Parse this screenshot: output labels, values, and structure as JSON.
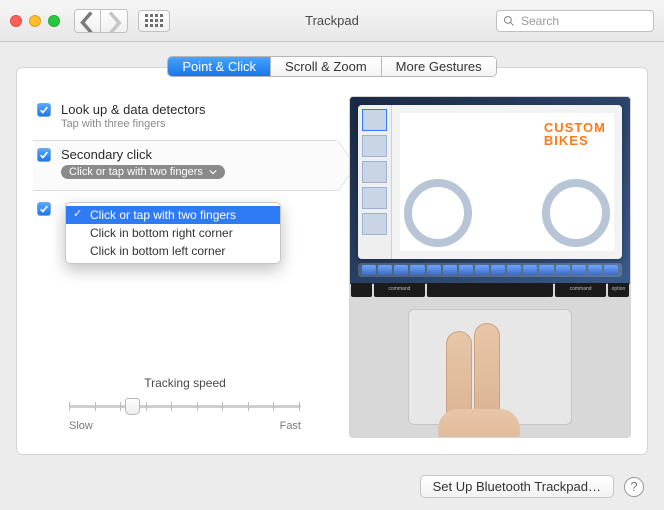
{
  "window": {
    "title": "Trackpad",
    "search_placeholder": "Search"
  },
  "tabs": [
    {
      "label": "Point & Click",
      "active": true
    },
    {
      "label": "Scroll & Zoom",
      "active": false
    },
    {
      "label": "More Gestures",
      "active": false
    }
  ],
  "options": {
    "lookup": {
      "title": "Look up & data detectors",
      "sub": "Tap with three fingers",
      "checked": true
    },
    "secondary": {
      "title": "Secondary click",
      "selected": "Click or tap with two fingers",
      "checked": true,
      "menu": [
        "Click or tap with two fingers",
        "Click in bottom right corner",
        "Click in bottom left corner"
      ]
    },
    "third": {
      "checked": true
    }
  },
  "tracking": {
    "label": "Tracking speed",
    "min_label": "Slow",
    "max_label": "Fast"
  },
  "preview": {
    "doc_line1": "CUSTOM",
    "doc_line2": "BIKES",
    "key_command": "command",
    "key_option": "option"
  },
  "footer": {
    "bluetooth": "Set Up Bluetooth Trackpad…",
    "help": "?"
  }
}
